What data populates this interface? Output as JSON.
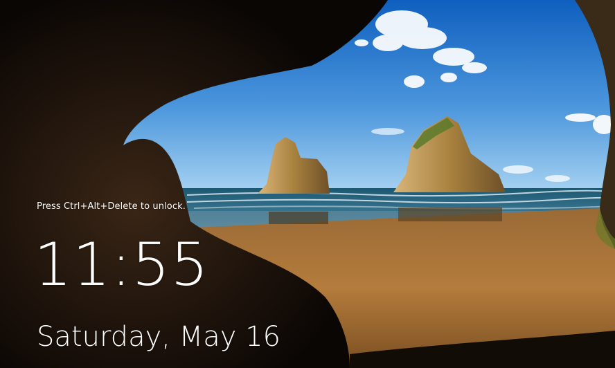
{
  "lock_screen": {
    "unlock_hint": "Press Ctrl+Alt+Delete to unlock.",
    "time": "11:55",
    "date": "Saturday, May 16"
  },
  "wallpaper": {
    "scene": "cave-beach-rocks",
    "colors": {
      "sky_top": "#1565c0",
      "sky_horizon": "#8ec5ef",
      "sea": "#2a5f7c",
      "sand": "#b07a3a",
      "rock": "#a07840",
      "cave": "#0c0806"
    }
  }
}
